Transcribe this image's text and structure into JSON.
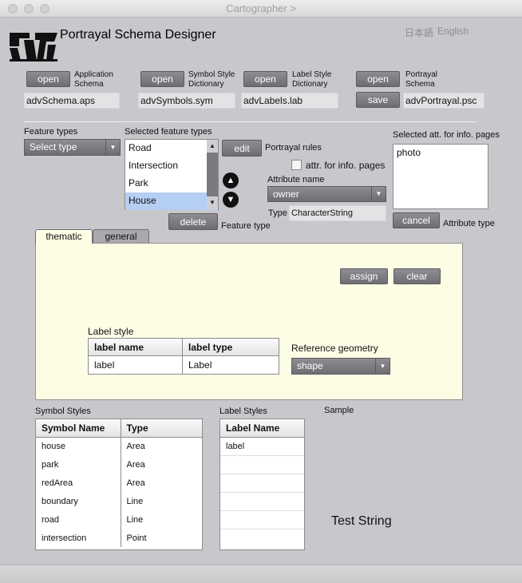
{
  "window": {
    "title": "Cartographer >"
  },
  "header": {
    "app_title": "Portrayal Schema Designer",
    "lang_ja": "日本語",
    "lang_en": "English"
  },
  "files": {
    "app_schema": {
      "button": "open",
      "label_line1": "Application",
      "label_line2": "Schema",
      "value": "advSchema.aps"
    },
    "symbol_dict": {
      "button": "open",
      "label_line1": "Symbol Style",
      "label_line2": "Dictionary",
      "value": "advSymbols.sym"
    },
    "label_dict": {
      "button": "open",
      "label_line1": "Label Style",
      "label_line2": "Dictionary",
      "value": "advLabels.lab"
    },
    "portrayal": {
      "button_open": "open",
      "button_save": "save",
      "label_line1": "Portrayal",
      "label_line2": "Schema",
      "value": "advPortrayal.psc"
    }
  },
  "features": {
    "types_label": "Feature types",
    "select_placeholder": "Select type",
    "selected_label": "Selected feature types",
    "items": [
      "Road",
      "Intersection",
      "Park",
      "House"
    ],
    "selected_index": 3,
    "edit_button": "edit",
    "portrayal_rules": "Portrayal rules",
    "delete_button": "delete",
    "feature_type_label": "Feature type"
  },
  "attributes": {
    "info_checkbox_label": "attr. for info. pages",
    "name_label": "Attribute name",
    "name_value": "owner",
    "type_label": "Type",
    "type_value": "CharacterString",
    "selected_info_label": "Selected att. for info. pages",
    "selected_info_items": [
      "photo"
    ],
    "cancel_button": "cancel",
    "attribute_type_label": "Attribute type"
  },
  "tabs": [
    {
      "label": "thematic",
      "active": true
    },
    {
      "label": "general",
      "active": false
    }
  ],
  "panel": {
    "assign_button": "assign",
    "clear_button": "clear",
    "label_style_title": "Label style",
    "label_table": {
      "headers": [
        "label name",
        "label type"
      ],
      "rows": [
        [
          "label",
          "Label"
        ]
      ]
    },
    "ref_geometry_label": "Reference geometry",
    "ref_geometry_value": "shape"
  },
  "symbol_styles": {
    "title": "Symbol Styles",
    "headers": [
      "Symbol Name",
      "Type"
    ],
    "rows": [
      [
        "house",
        "Area"
      ],
      [
        "park",
        "Area"
      ],
      [
        "redArea",
        "Area"
      ],
      [
        "boundary",
        "Line"
      ],
      [
        "road",
        "Line"
      ],
      [
        "intersection",
        "Point"
      ]
    ]
  },
  "label_styles": {
    "title": "Label Styles",
    "headers": [
      "Label Name"
    ],
    "rows": [
      "label"
    ]
  },
  "sample": {
    "title": "Sample",
    "text": "Test String"
  },
  "colors": {
    "selected_row": "#b5cef3",
    "panel_bg": "#fdfde6",
    "window_bg": "#c8c7cc"
  }
}
